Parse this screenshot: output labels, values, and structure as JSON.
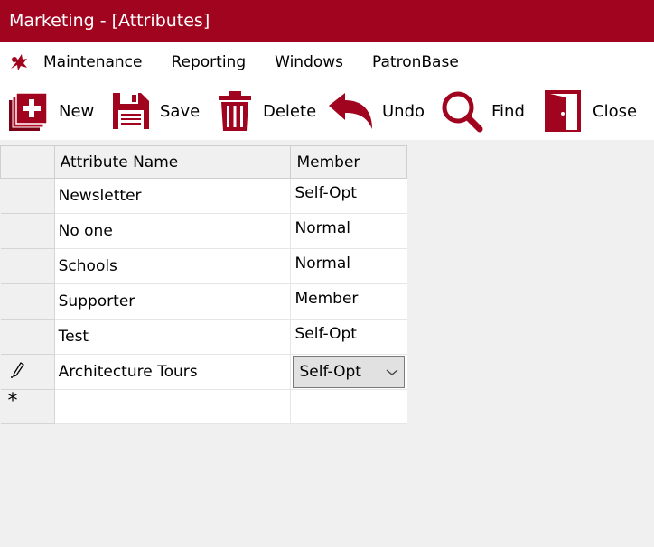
{
  "window": {
    "title": "Marketing - [Attributes]"
  },
  "menu": {
    "items": [
      {
        "label": "Maintenance"
      },
      {
        "label": "Reporting"
      },
      {
        "label": "Windows"
      },
      {
        "label": "PatronBase"
      }
    ]
  },
  "toolbar": {
    "new_label": "New",
    "save_label": "Save",
    "delete_label": "Delete",
    "undo_label": "Undo",
    "find_label": "Find",
    "close_label": "Close",
    "icon_color": "#a1041e"
  },
  "grid": {
    "headers": {
      "name": "Attribute Name",
      "member": "Member"
    },
    "rows": [
      {
        "name": "Newsletter",
        "member": "Self-Opt"
      },
      {
        "name": "No one",
        "member": "Normal"
      },
      {
        "name": "Schools",
        "member": "Normal"
      },
      {
        "name": "Supporter",
        "member": "Member"
      },
      {
        "name": "Test",
        "member": "Self-Opt"
      }
    ],
    "editing_row": {
      "name": "Architecture Tours",
      "member": "Self-Opt",
      "indicator": "pencil-icon"
    },
    "new_row_marker": "*"
  }
}
